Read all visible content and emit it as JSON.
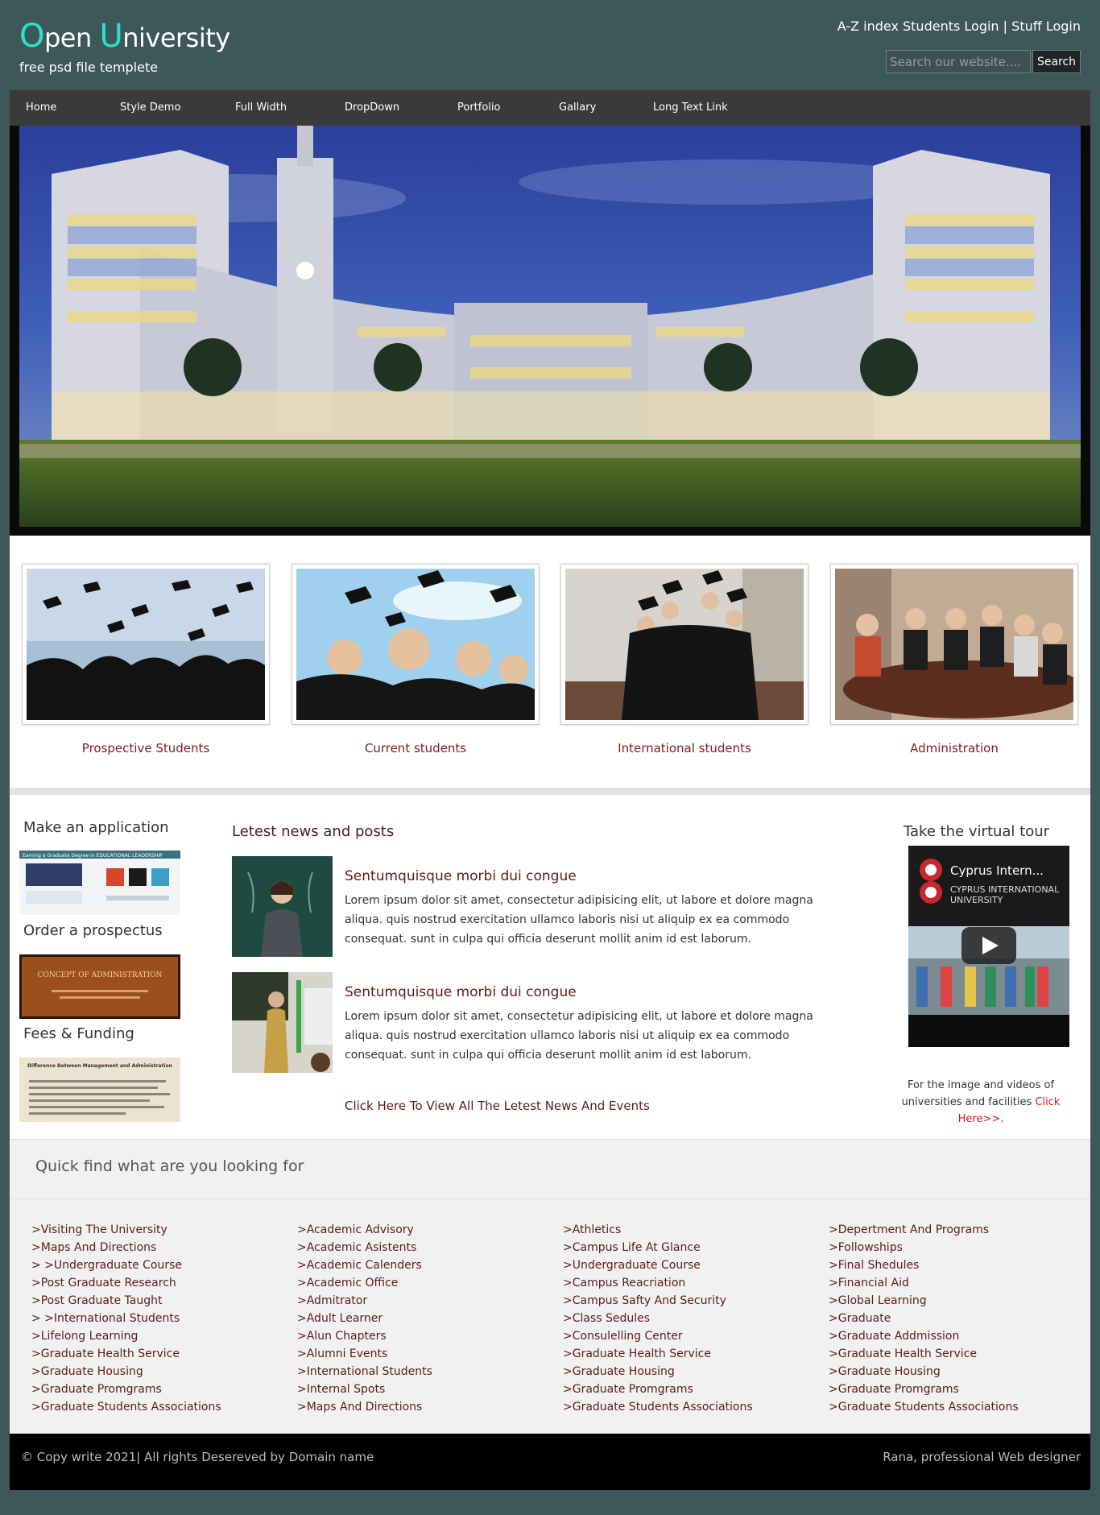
{
  "header": {
    "logo_o": "O",
    "logo_pen": "pen ",
    "logo_u": "U",
    "logo_niversity": "niversity",
    "tagline": "free psd file templete",
    "toplinks": {
      "az_index": "A-Z index",
      "students_login": "Students Login",
      "separator": "|",
      "stuff_login": "Stuff Login"
    },
    "search": {
      "placeholder": "Search our website....",
      "button": "Search"
    }
  },
  "nav": [
    "Home",
    "Style Demo",
    "Full Width",
    "DropDown",
    "Portfolio",
    "Gallary",
    "Long Text Link"
  ],
  "cards": [
    {
      "label": "Prospective Students"
    },
    {
      "label": "Current students"
    },
    {
      "label": "International students"
    },
    {
      "label": "Administration"
    }
  ],
  "sidebar": {
    "apply": "Make an application",
    "prospectus": "Order a prospectus",
    "fees": "Fees & Funding",
    "apply_img_title": "Earning a Graduate Degree in EDUCATIONAL LEADERSHIP",
    "prospectus_img_title": "CONCEPT OF ADMINISTRATION",
    "fees_img_title": "Difference Between Management and Administration"
  },
  "news": {
    "title": "Letest news and posts",
    "posts": [
      {
        "title": "Sentumquisque morbi dui congue",
        "body": "Lorem ipsum dolor sit amet, consectetur adipisicing elit, ut labore et dolore magna aliqua. quis nostrud exercitation ullamco laboris nisi ut aliquip ex ea commodo consequat. sunt in culpa qui officia deserunt mollit anim id est laborum."
      },
      {
        "title": "Sentumquisque morbi dui congue",
        "body": "Lorem ipsum dolor sit amet, consectetur adipisicing elit, ut labore et dolore magna aliqua. quis nostrud exercitation ullamco laboris nisi ut aliquip ex ea commodo consequat. sunt in culpa qui officia deserunt mollit anim id est laborum."
      }
    ],
    "view_all": "Click Here To View All The Letest News And Events"
  },
  "tour": {
    "title": "Take the virtual tour",
    "video_title": "Cyprus Intern...",
    "video_logo_text": "CYPRUS INTERNATIONAL UNIVERSITY",
    "note_pre": "For the image and videos of universities and facilities",
    "note_link": "Click Here>>",
    "note_post": "."
  },
  "quickfind": {
    "title": "Quick find what are you looking for",
    "columns": [
      [
        ">Visiting The University",
        ">Maps And Directions",
        "> >Undergraduate Course",
        ">Post Graduate Research",
        ">Post Graduate Taught",
        "> >International Students",
        ">Lifelong Learning",
        ">Graduate Health Service",
        ">Graduate Housing",
        ">Graduate Promgrams",
        ">Graduate Students Associations"
      ],
      [
        ">Academic Advisory",
        ">Academic Asistents",
        ">Academic Calenders",
        ">Academic Office",
        ">Admitrator",
        ">Adult Learner",
        ">Alun Chapters",
        ">Alumni Events",
        ">International Students",
        ">Internal Spots",
        ">Maps And Directions"
      ],
      [
        ">Athletics",
        ">Campus Life At Glance",
        ">Undergraduate Course",
        ">Campus Reacriation",
        ">Campus Safty And Security",
        ">Class Sedules",
        ">Consulelling Center",
        ">Graduate Health Service",
        ">Graduate Housing",
        ">Graduate Promgrams",
        ">Graduate Students Associations"
      ],
      [
        ">Depertment And Programs",
        ">Followships",
        ">Final Shedules",
        ">Financial Aid",
        ">Global Learning",
        ">Graduate",
        ">Graduate Addmission",
        ">Graduate Health Service",
        ">Graduate Housing",
        ">Graduate Promgrams",
        ">Graduate Students Associations"
      ]
    ]
  },
  "footer": {
    "copyright": "© Copy write 2021| All rights Desereved by Domain name",
    "credit": "Rana, professional Web designer"
  },
  "colors": {
    "page_bg": "#3e575b",
    "logo_accent": "#2ee0c7",
    "link_maroon": "#7a1c24",
    "nav_bg": "#3a3a3a",
    "footer_bg": "#000000"
  }
}
